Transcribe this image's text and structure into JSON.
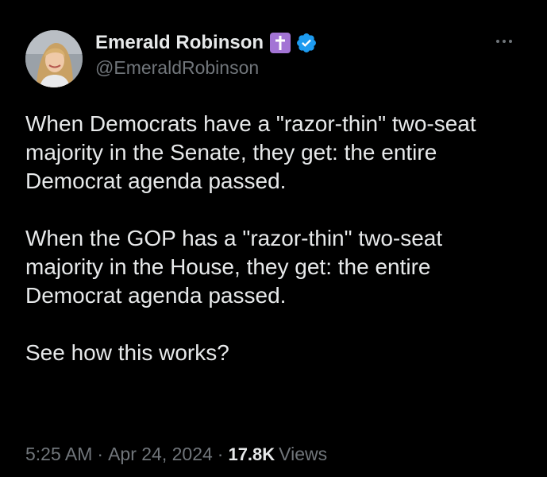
{
  "author": {
    "display_name": "Emerald Robinson",
    "handle": "@EmeraldRobinson",
    "badges": [
      "cross-icon",
      "verified-icon"
    ]
  },
  "tweet": {
    "paragraphs": [
      "When Democrats have a \"razor-thin\" two-seat majority in the Senate, they get: the entire Democrat agenda passed.",
      "When the GOP has a \"razor-thin\" two-seat majority in the House, they get: the entire Democrat agenda passed.",
      "See how this works?"
    ]
  },
  "meta": {
    "time": "5:25 AM",
    "date": "Apr 24, 2024",
    "views_count": "17.8K",
    "views_label": "Views",
    "separator": "·"
  },
  "colors": {
    "background": "#000000",
    "text_primary": "#e7e9ea",
    "text_secondary": "#71767b",
    "verified_blue": "#1d9bf0",
    "cross_badge_purple": "#a374d5"
  }
}
